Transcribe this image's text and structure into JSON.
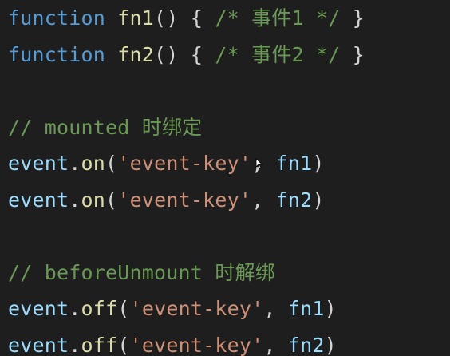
{
  "code": {
    "line1": {
      "keyword": "function",
      "name": "fn1",
      "parens": "()",
      "open": "{",
      "comment": "/* 事件1 */",
      "close": "}"
    },
    "line2": {
      "keyword": "function",
      "name": "fn2",
      "parens": "()",
      "open": "{",
      "comment": "/* 事件2 */",
      "close": "}"
    },
    "line4": {
      "comment": "// mounted 时绑定"
    },
    "line5": {
      "object": "event",
      "dot": ".",
      "method": "on",
      "open": "(",
      "string": "'event-key'",
      "comma": ",",
      "arg": "fn1",
      "close": ")"
    },
    "line6": {
      "object": "event",
      "dot": ".",
      "method": "on",
      "open": "(",
      "string": "'event-key'",
      "comma": ",",
      "arg": "fn2",
      "close": ")"
    },
    "line8": {
      "comment": "// beforeUnmount 时解绑"
    },
    "line9": {
      "object": "event",
      "dot": ".",
      "method": "off",
      "open": "(",
      "string": "'event-key'",
      "comma": ",",
      "arg": "fn1",
      "close": ")"
    },
    "line10": {
      "object": "event",
      "dot": ".",
      "method": "off",
      "open": "(",
      "string": "'event-key'",
      "comma": ",",
      "arg": "fn2",
      "close": ")"
    }
  },
  "colors": {
    "background": "#1e1e1e",
    "keyword": "#569cd6",
    "function": "#dcdcaa",
    "punctuation": "#d4d4d4",
    "comment": "#6a9955",
    "variable": "#9cdcfe",
    "string": "#ce9178"
  },
  "icons": {
    "cursor": "mouse-pointer-icon"
  }
}
